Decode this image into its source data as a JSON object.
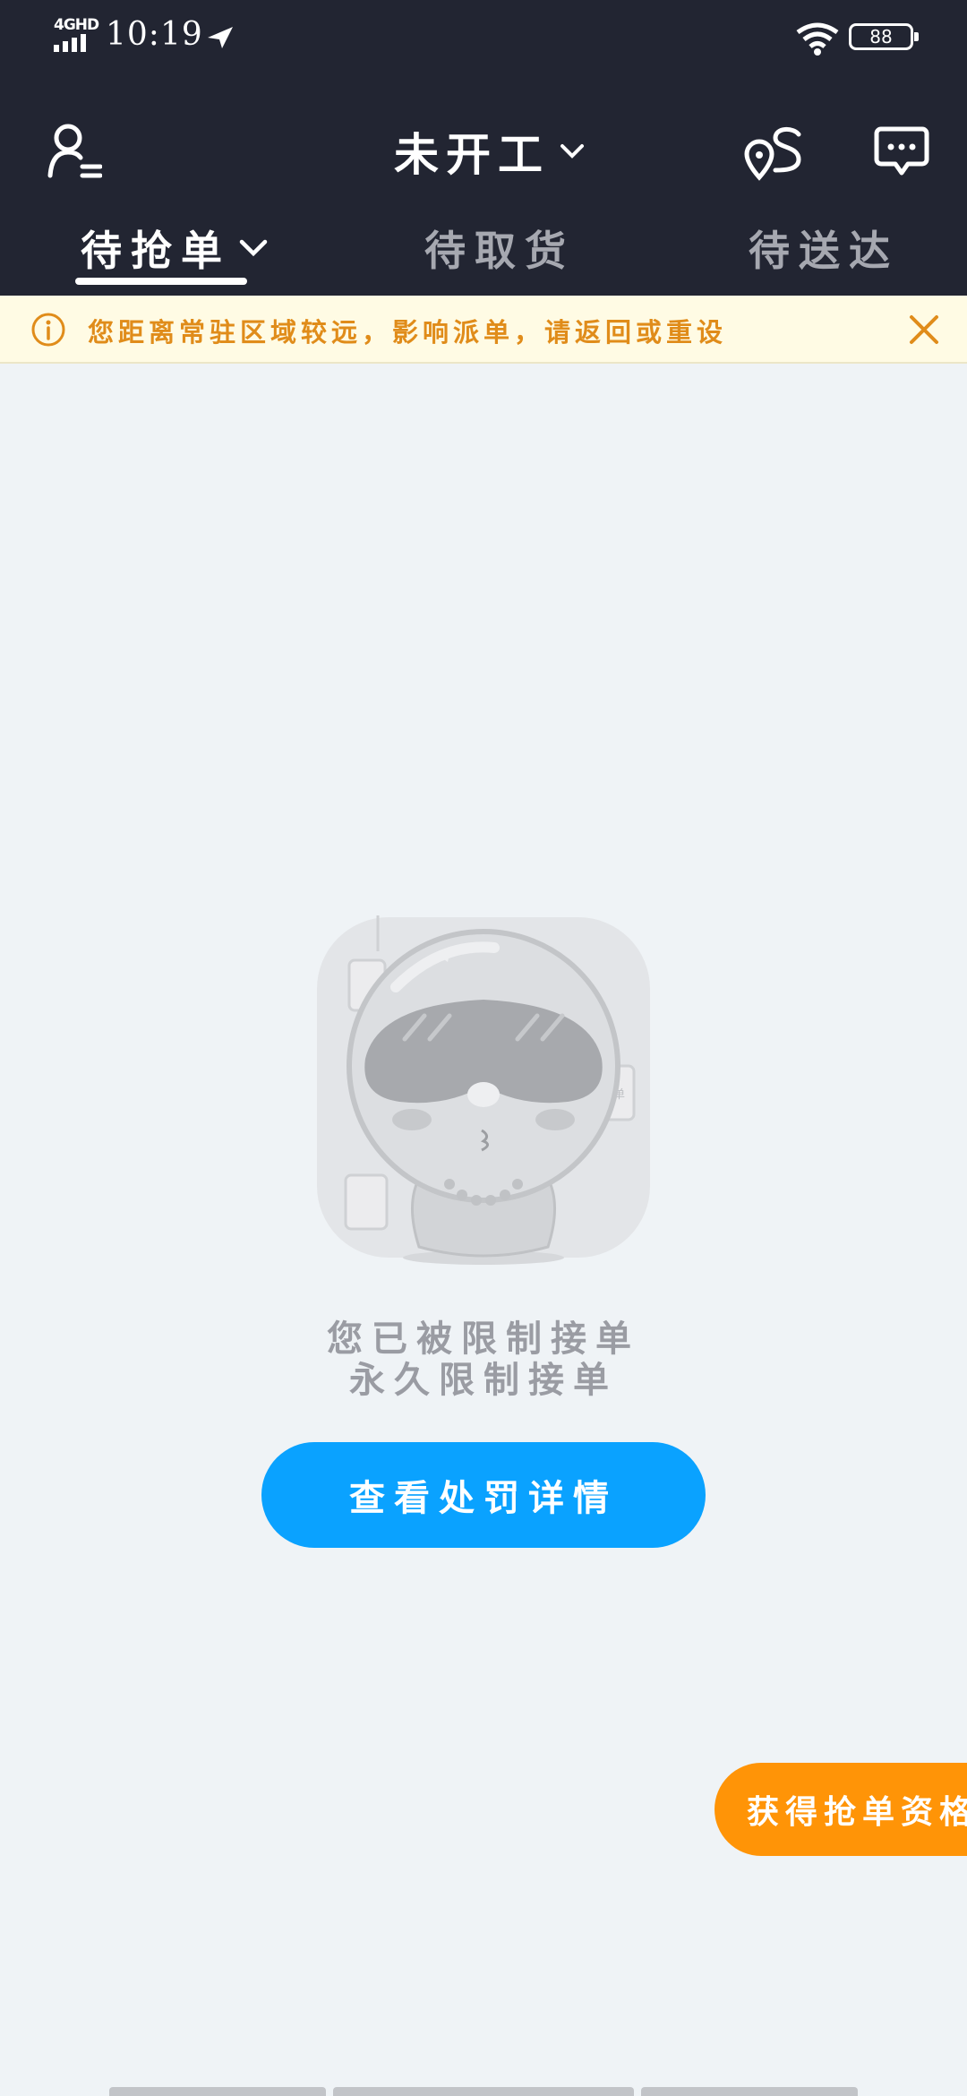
{
  "status_bar": {
    "network": "4GHD",
    "time": "10:19",
    "battery": "88"
  },
  "header": {
    "title": "未开工"
  },
  "tabs": [
    {
      "label": "待抢单",
      "active": true
    },
    {
      "label": "待取货",
      "active": false
    },
    {
      "label": "待送达",
      "active": false
    }
  ],
  "notice": {
    "text": "您距离常驻区域较远，影响派单，请返回或重设"
  },
  "empty_state": {
    "line1": "您已被限制接单",
    "line2": "永久限制接单",
    "illustration_tag": "订单"
  },
  "buttons": {
    "penalty_details": "查看处罚详情",
    "get_qualification": "获得抢单资格"
  },
  "colors": {
    "header_bg": "#222532",
    "page_bg": "#eff3f6",
    "notice_bg": "#fffbe4",
    "notice_text": "#e08c1a",
    "primary": "#0aa2ff",
    "accent": "#ff9407"
  }
}
